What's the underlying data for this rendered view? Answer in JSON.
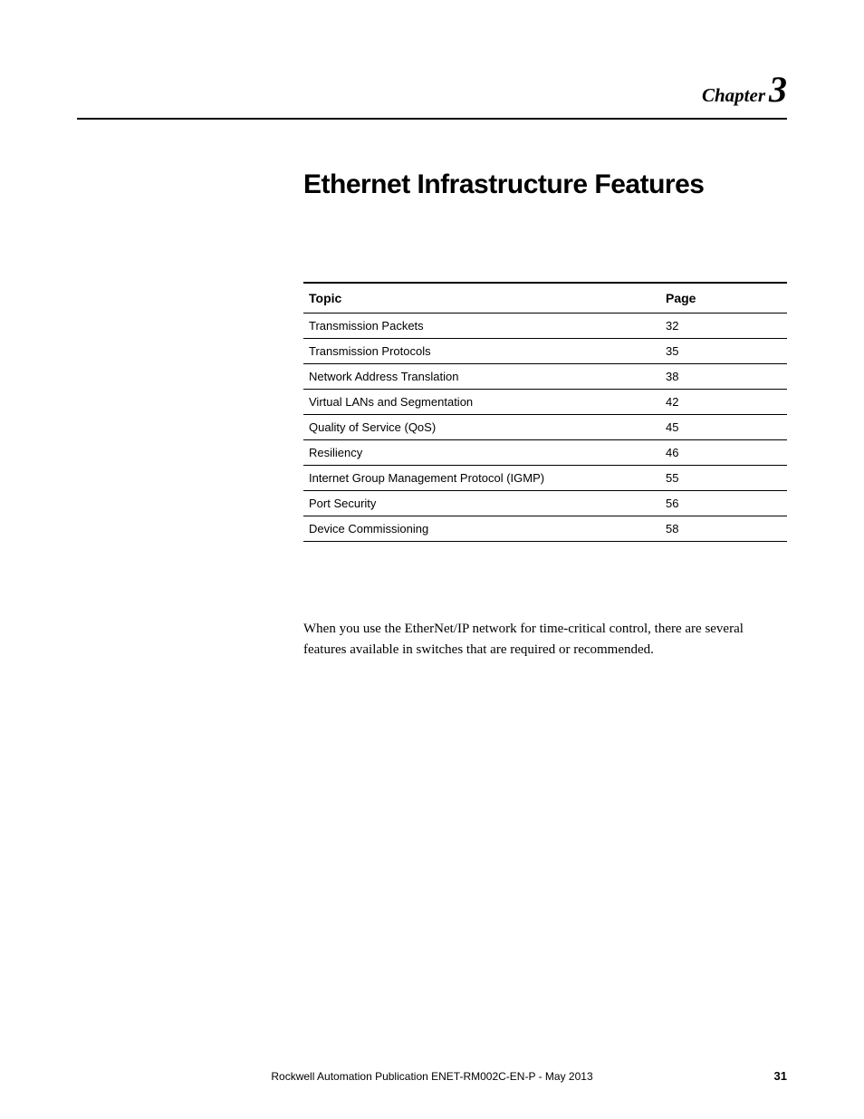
{
  "chapter": {
    "label": "Chapter",
    "number": "3"
  },
  "title": "Ethernet Infrastructure Features",
  "toc": {
    "headers": {
      "topic": "Topic",
      "page": "Page"
    },
    "rows": [
      {
        "topic": "Transmission Packets",
        "page": "32"
      },
      {
        "topic": "Transmission Protocols",
        "page": "35"
      },
      {
        "topic": "Network Address Translation",
        "page": "38"
      },
      {
        "topic": "Virtual LANs and Segmentation",
        "page": "42"
      },
      {
        "topic": "Quality of Service (QoS)",
        "page": "45"
      },
      {
        "topic": "Resiliency",
        "page": "46"
      },
      {
        "topic": "Internet Group Management Protocol (IGMP)",
        "page": "55"
      },
      {
        "topic": "Port Security",
        "page": "56"
      },
      {
        "topic": "Device Commissioning",
        "page": "58"
      }
    ]
  },
  "body_text": "When you use the EtherNet/IP network for time-critical control, there are several features available in switches that are required or recommended.",
  "footer": {
    "publication": "Rockwell Automation Publication ENET-RM002C-EN-P - May 2013",
    "page_number": "31"
  }
}
